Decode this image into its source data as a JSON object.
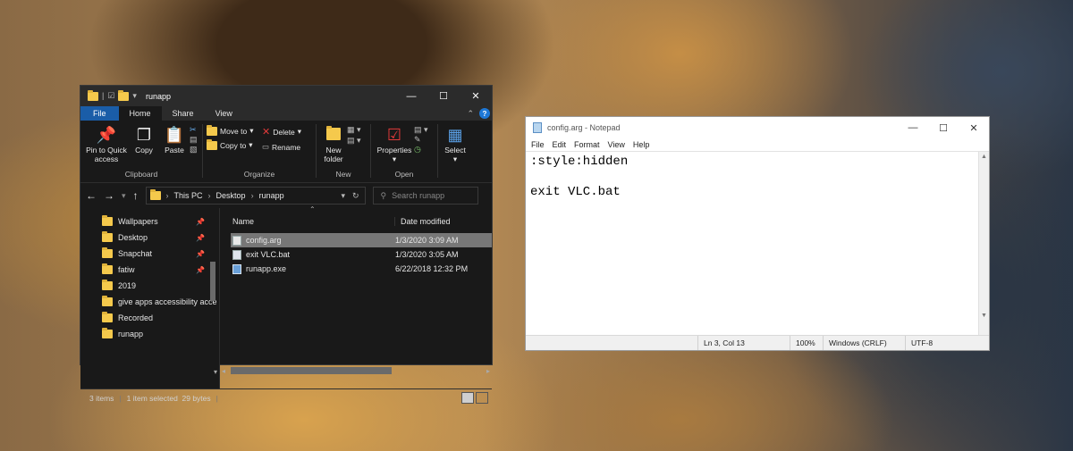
{
  "explorer": {
    "title": "runapp",
    "window_controls": {
      "minimize": "—",
      "maximize": "☐",
      "close": "✕"
    },
    "tabs": [
      {
        "label": "File"
      },
      {
        "label": "Home"
      },
      {
        "label": "Share"
      },
      {
        "label": "View"
      }
    ],
    "ribbon": {
      "clipboard": {
        "group_label": "Clipboard",
        "pin_label": "Pin to Quick access",
        "copy_label": "Copy",
        "paste_label": "Paste"
      },
      "organize": {
        "group_label": "Organize",
        "move_to": "Move to",
        "copy_to": "Copy to",
        "delete": "Delete",
        "rename": "Rename"
      },
      "new": {
        "group_label": "New",
        "new_folder": "New folder"
      },
      "open": {
        "group_label": "Open",
        "properties": "Properties"
      },
      "select": {
        "label": "Select"
      }
    },
    "address": {
      "segments": [
        "This PC",
        "Desktop",
        "runapp"
      ]
    },
    "search": {
      "placeholder": "Search runapp"
    },
    "nav_items": [
      {
        "label": "Wallpapers",
        "pinned": true
      },
      {
        "label": "Desktop",
        "pinned": true
      },
      {
        "label": "Snapchat",
        "pinned": true
      },
      {
        "label": "fatiw",
        "pinned": true
      },
      {
        "label": "2019",
        "pinned": false
      },
      {
        "label": "give apps accessibility acce",
        "pinned": false
      },
      {
        "label": "Recorded",
        "pinned": false
      },
      {
        "label": "runapp",
        "pinned": false
      }
    ],
    "columns": {
      "name": "Name",
      "date": "Date modified"
    },
    "files": [
      {
        "name": "config.arg",
        "date": "1/3/2020 3:09 AM",
        "type": "arg",
        "selected": true
      },
      {
        "name": "exit VLC.bat",
        "date": "1/3/2020 3:05 AM",
        "type": "bat",
        "selected": false
      },
      {
        "name": "runapp.exe",
        "date": "6/22/2018 12:32 PM",
        "type": "exe",
        "selected": false
      }
    ],
    "status": {
      "count": "3 items",
      "selected": "1 item selected  29 bytes"
    }
  },
  "notepad": {
    "title": "config.arg - Notepad",
    "window_controls": {
      "minimize": "—",
      "maximize": "☐",
      "close": "✕"
    },
    "menu": [
      "File",
      "Edit",
      "Format",
      "View",
      "Help"
    ],
    "content": ":style:hidden\n\nexit VLC.bat",
    "status": {
      "position": "Ln 3, Col 13",
      "zoom": "100%",
      "line_ending": "Windows (CRLF)",
      "encoding": "UTF-8"
    }
  },
  "colors": {
    "file_tab": "#1a5da8",
    "folder": "#f5c94c",
    "explorer_bg": "#191919",
    "selection": "#777777"
  }
}
